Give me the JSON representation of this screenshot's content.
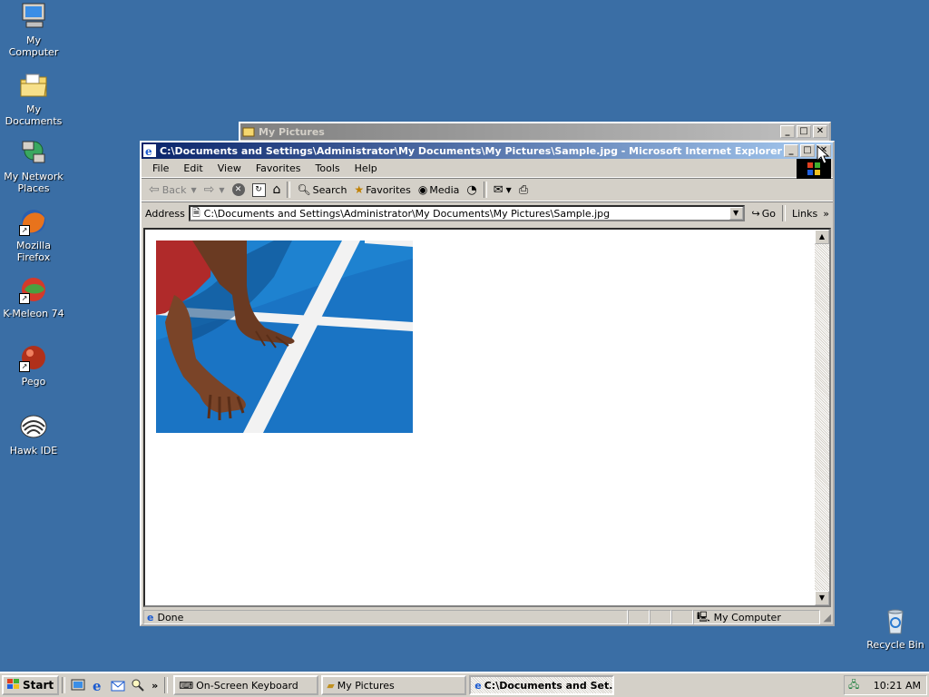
{
  "desktop": {
    "icons": [
      {
        "label": "My Computer",
        "icon": "computer-icon"
      },
      {
        "label": "My Documents",
        "icon": "folder-icon"
      },
      {
        "label": "My Network Places",
        "icon": "network-icon"
      },
      {
        "label": "Mozilla Firefox",
        "icon": "firefox-icon"
      },
      {
        "label": "K-Meleon 74",
        "icon": "kmeleon-icon"
      },
      {
        "label": "Pego",
        "icon": "pego-icon"
      },
      {
        "label": "Hawk IDE",
        "icon": "hawk-icon"
      },
      {
        "label": "Recycle Bin",
        "icon": "recycle-bin-icon"
      }
    ]
  },
  "back_window": {
    "title": "My Pictures"
  },
  "ie_window": {
    "title": "C:\\Documents and Settings\\Administrator\\My Documents\\My Pictures\\Sample.jpg - Microsoft Internet Explorer",
    "menu": [
      "File",
      "Edit",
      "View",
      "Favorites",
      "Tools",
      "Help"
    ],
    "toolbar": {
      "back": "Back",
      "search": "Search",
      "favorites": "Favorites",
      "media": "Media"
    },
    "address": {
      "label": "Address",
      "value": "C:\\Documents and Settings\\Administrator\\My Documents\\My Pictures\\Sample.jpg",
      "go": "Go",
      "links": "Links"
    },
    "status": {
      "text": "Done",
      "zone": "My Computer"
    }
  },
  "taskbar": {
    "start": "Start",
    "buttons": [
      "On-Screen Keyboard",
      "My Pictures",
      "C:\\Documents and Set..."
    ],
    "clock": "10:21 AM"
  }
}
